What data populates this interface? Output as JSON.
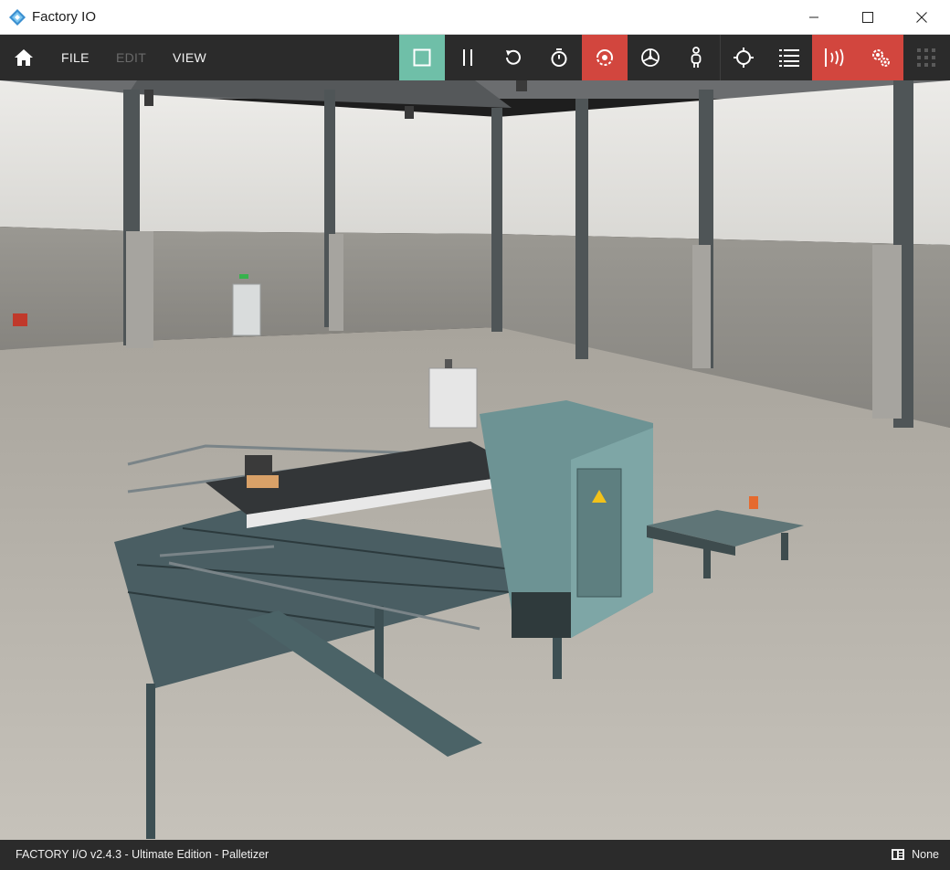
{
  "window": {
    "title": "Factory IO"
  },
  "menu": {
    "file": "FILE",
    "edit": "EDIT",
    "view": "VIEW"
  },
  "toolbar": {
    "buttons": [
      {
        "name": "stop-icon",
        "state": "active-green"
      },
      {
        "name": "pause-icon",
        "state": "normal"
      },
      {
        "name": "reset-icon",
        "state": "normal"
      },
      {
        "name": "stopwatch-icon",
        "state": "normal"
      },
      {
        "name": "camera-orbit-icon",
        "state": "active-red"
      },
      {
        "name": "fly-camera-icon",
        "state": "normal"
      },
      {
        "name": "first-person-icon",
        "state": "normal"
      },
      {
        "name": "crosshair-icon",
        "state": "normal"
      },
      {
        "name": "list-icon",
        "state": "normal"
      },
      {
        "name": "sensors-icon",
        "state": "active-red"
      },
      {
        "name": "drivers-icon",
        "state": "active-red"
      },
      {
        "name": "grid-icon",
        "state": "disabled"
      }
    ]
  },
  "colors": {
    "accent_green": "#6fbfa8",
    "accent_red": "#d2463e",
    "bar": "#2b2b2b"
  },
  "status": {
    "text": "FACTORY I/O v2.4.3 - Ultimate Edition - Palletizer",
    "driver": "None"
  }
}
